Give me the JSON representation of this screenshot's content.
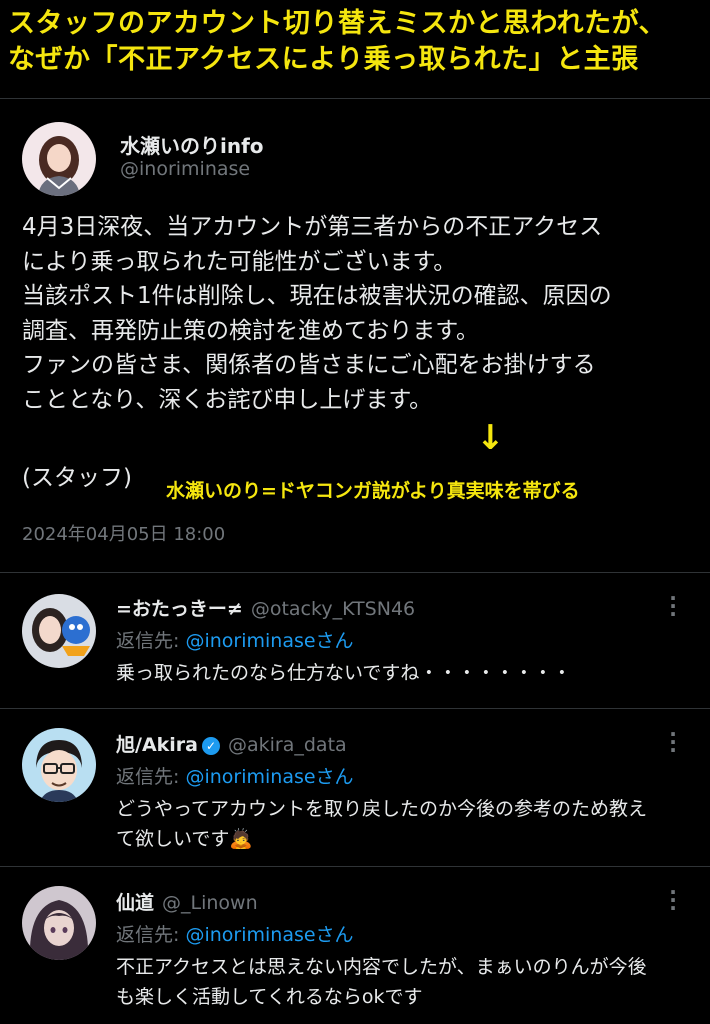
{
  "headline": {
    "line1": "スタッフのアカウント切り替えミスかと思われたが、",
    "line2": "なぜか「不正アクセスにより乗っ取られた」と主張"
  },
  "main_post": {
    "display_name": "水瀬いのりinfo",
    "handle": "@inoriminase",
    "body_lines": [
      "4月3日深夜、当アカウントが第三者からの不正アクセス",
      "により乗っ取られた可能性がございます。",
      "当該ポスト1件は削除し、現在は被害状況の確認、原因の",
      "調査、再発防止策の検討を進めております。",
      "ファンの皆さま、関係者の皆さまにご心配をお掛けする",
      "こととなり、深くお詫び申し上げます。"
    ],
    "signature": "(スタッフ)",
    "timestamp": "2024年04月05日 18:00"
  },
  "annotation": {
    "arrow": "↓",
    "text": "水瀬いのり=ドヤコンガ説がより真実味を帯びる"
  },
  "replies": [
    {
      "display_name": "=おたっきー≠",
      "handle": "@otacky_KTSN46",
      "verified": false,
      "reply_to_label": "返信先: ",
      "reply_to_mention": "@inoriminaseさん",
      "text_lines": [
        "乗っ取られたのなら仕方ないですね・・・・・・・・"
      ]
    },
    {
      "display_name": "旭/Akira",
      "handle": "@akira_data",
      "verified": true,
      "reply_to_label": "返信先: ",
      "reply_to_mention": "@inoriminaseさん",
      "text_lines": [
        "どうやってアカウントを取り戻したのか今後の参考のため教え",
        "て欲しいです🙇"
      ]
    },
    {
      "display_name": "仙道",
      "handle": "@_Linown",
      "verified": false,
      "reply_to_label": "返信先: ",
      "reply_to_mention": "@inoriminaseさん",
      "text_lines": [
        "不正アクセスとは思えない内容でしたが、まぁいのりんが今後",
        "も楽しく活動してくれるならokです"
      ]
    }
  ],
  "icons": {
    "more": "more-vertical-icon",
    "verified": "verified-badge-icon"
  },
  "colors": {
    "background": "#000000",
    "headline": "#f5e60f",
    "primary_text": "#e7e9ea",
    "secondary_text": "#71767b",
    "mention": "#1d9bf0"
  }
}
